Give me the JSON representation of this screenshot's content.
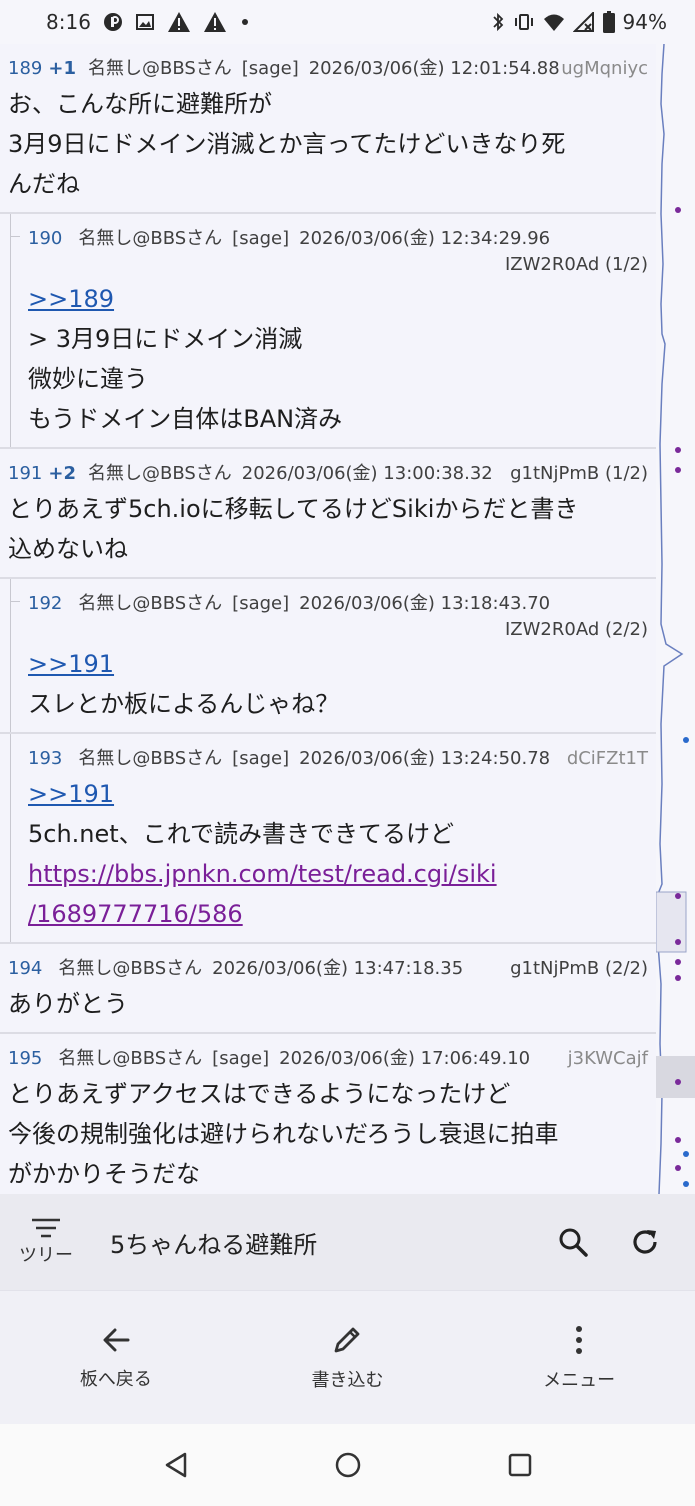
{
  "status_bar": {
    "time": "8:16",
    "battery": "94%",
    "icons": [
      "p-badge-icon",
      "image-icon",
      "warning-icon",
      "warning-icon",
      "dot-icon",
      "bluetooth-icon",
      "vibrate-icon",
      "wifi-icon",
      "no-signal-icon",
      "battery-icon"
    ]
  },
  "posts": [
    {
      "num": "189",
      "plus": "+1",
      "name": "名無し@BBSさん",
      "mail": "[sage]",
      "date": "2026/03/06(金) 12:01:54.88",
      "id": "ugMqniyc",
      "lines": [
        "お、こんな所に避難所が",
        "3月9日にドメイン消滅とか言ってたけどいきなり死",
        "んだね"
      ]
    },
    {
      "num": "190",
      "name": "名無し@BBSさん",
      "mail": "[sage]",
      "date": "2026/03/06(金) 12:34:29.96",
      "id": "IZW2R0Ad (1/2)",
      "anchor": ">>189",
      "lines": [
        "> 3月9日にドメイン消滅",
        "微妙に違う",
        "もうドメイン自体はBAN済み"
      ]
    },
    {
      "num": "191",
      "plus": "+2",
      "name": "名無し@BBSさん",
      "date": "2026/03/06(金) 13:00:38.32",
      "id": "g1tNjPmB (1/2)",
      "lines": [
        "とりあえず5ch.ioに移転してるけどSikiからだと書き",
        "込めないね"
      ]
    },
    {
      "num": "192",
      "name": "名無し@BBSさん",
      "mail": "[sage]",
      "date": "2026/03/06(金) 13:18:43.70",
      "id": "IZW2R0Ad (2/2)",
      "anchor": ">>191",
      "lines": [
        "スレとか板によるんじゃね？"
      ]
    },
    {
      "num": "193",
      "name": "名無し@BBSさん",
      "mail": "[sage]",
      "date": "2026/03/06(金) 13:24:50.78",
      "id": "dCiFZt1T",
      "anchor": ">>191",
      "lines": [
        "5ch.net、これで読み書きできてるけど"
      ],
      "url_lines": [
        "https://bbs.jpnkn.com/test/read.cgi/siki",
        "/1689777716/586"
      ]
    },
    {
      "num": "194",
      "name": "名無し@BBSさん",
      "date": "2026/03/06(金) 13:47:18.35",
      "id": "g1tNjPmB (2/2)",
      "lines": [
        "ありがとう"
      ]
    },
    {
      "num": "195",
      "name": "名無し@BBSさん",
      "mail": "[sage]",
      "date": "2026/03/06(金) 17:06:49.10",
      "id": "j3KWCajf",
      "lines": [
        "とりあえずアクセスはできるようになったけど",
        "今後の規制強化は避けられないだろうし衰退に拍車",
        "がかかりそうだな"
      ]
    }
  ],
  "toolbar": {
    "tree_label": "ツリー",
    "board_title": "5ちゃんねる避難所",
    "icons": [
      "filter-sort-icon",
      "search-icon",
      "refresh-icon"
    ]
  },
  "actions": {
    "back_label": "板へ戻る",
    "write_label": "書き込む",
    "menu_label": "メニュー"
  },
  "colors": {
    "anchor": "#1f58b0",
    "visited_link": "#7a1f98",
    "post_number": "#2b5fa0",
    "minimap_purple": "#7a2a9a",
    "minimap_blue": "#2a6acc"
  }
}
